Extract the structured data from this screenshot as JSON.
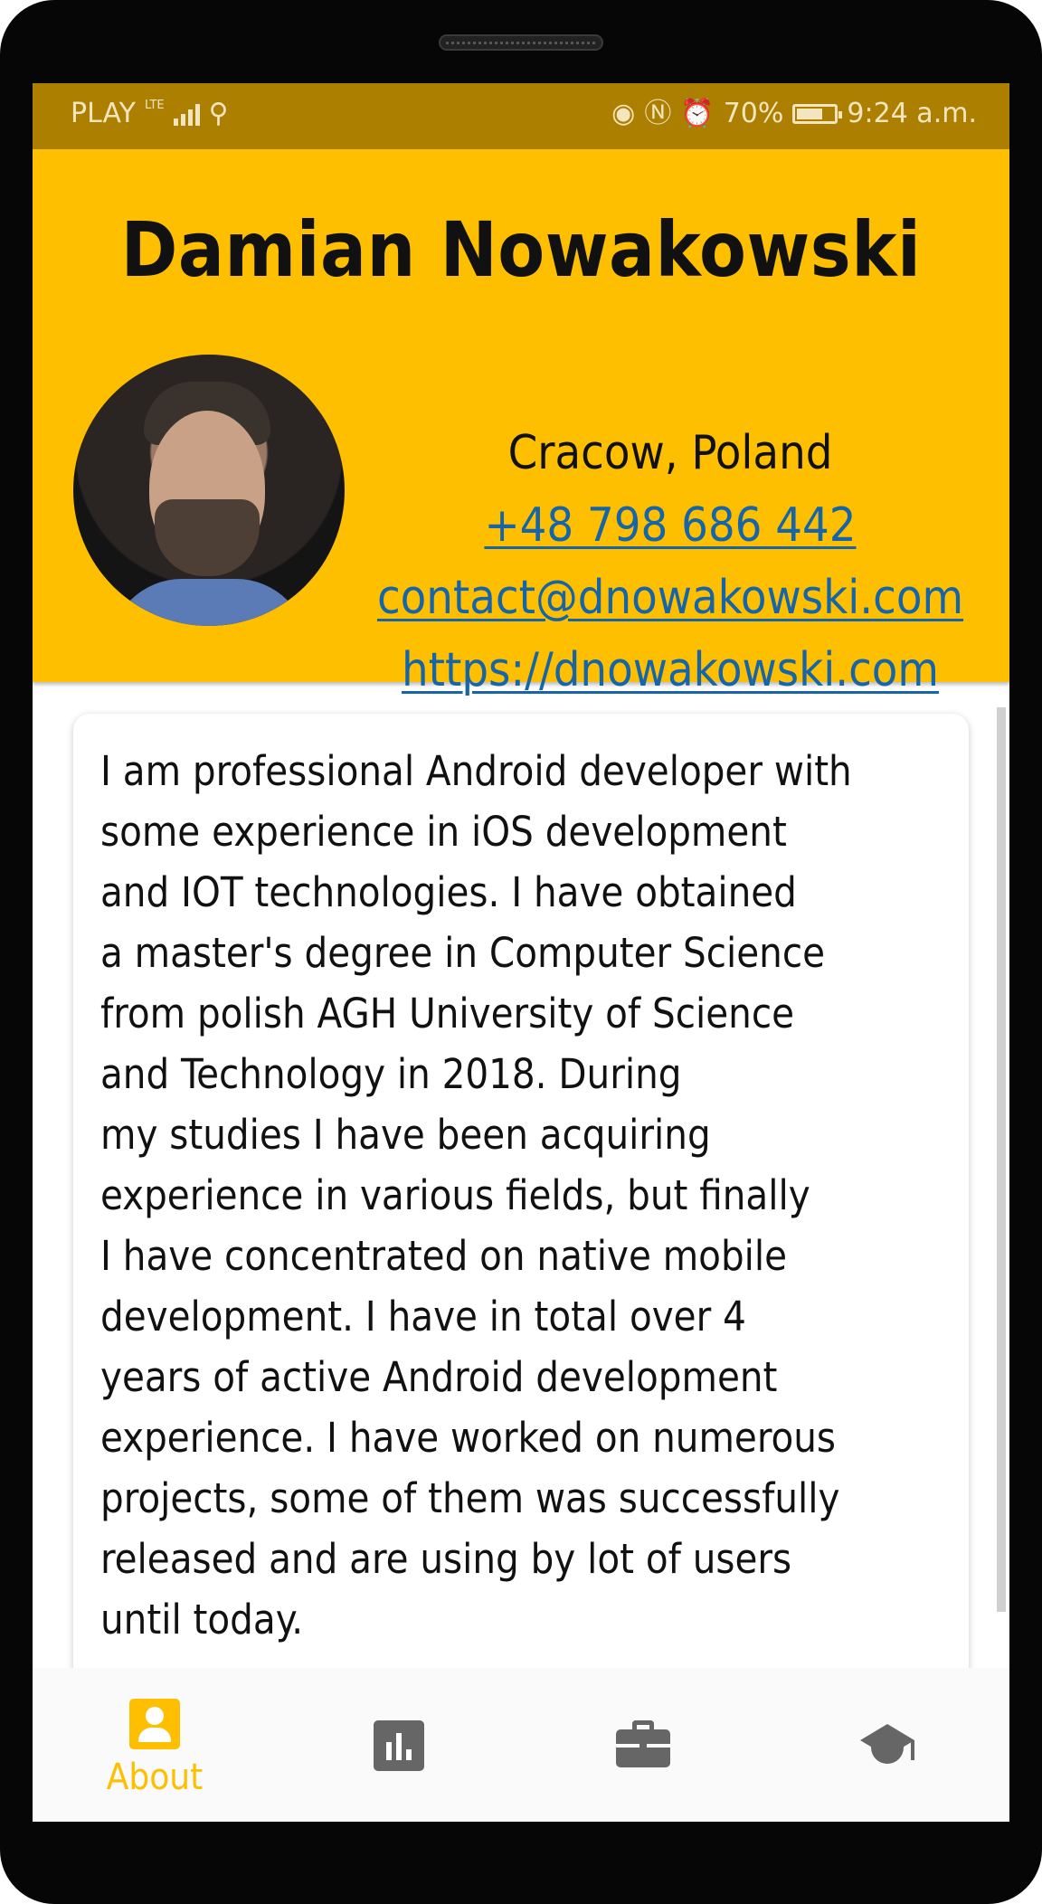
{
  "status_bar": {
    "carrier": "PLAY",
    "network": "LTE",
    "battery_percent": "70%",
    "time": "9:24 a.m."
  },
  "profile": {
    "name": "Damian Nowakowski",
    "location": "Cracow, Poland",
    "phone": "+48 798 686 442",
    "email": "contact@dnowakowski.com",
    "website": "https://dnowakowski.com"
  },
  "about": {
    "bio": "I am professional Android developer with\nsome experience in iOS development\nand IOT technologies. I have obtained\na master's degree in Computer Science\nfrom polish AGH University of Science\nand Technology in 2018. During\nmy studies I have been acquiring\nexperience in various fields, but finally\nI have concentrated on native mobile\ndevelopment. I have in total over 4\nyears of active Android development\nexperience. I have worked on numerous\nprojects, some of them was successfully\nreleased and are using by lot of users\nuntil today."
  },
  "bottom_nav": {
    "items": [
      {
        "label": "About",
        "icon": "person-icon",
        "active": true
      },
      {
        "label": "",
        "icon": "bar-chart-icon",
        "active": false
      },
      {
        "label": "",
        "icon": "briefcase-icon",
        "active": false
      },
      {
        "label": "",
        "icon": "graduation-cap-icon",
        "active": false
      }
    ]
  },
  "colors": {
    "accent": "#fdbf00",
    "status_bar": "#ad7f00",
    "link": "#1565a8",
    "inactive_icon": "#666666"
  }
}
